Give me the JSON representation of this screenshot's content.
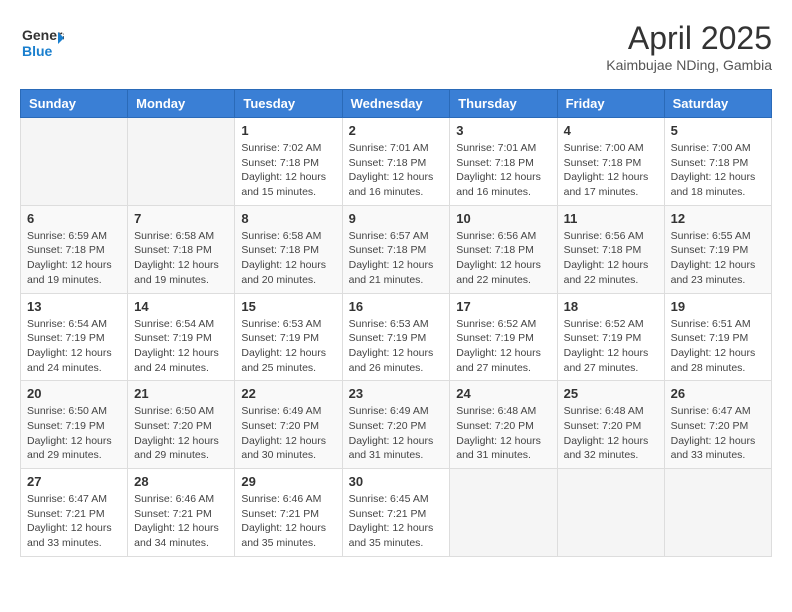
{
  "header": {
    "logo_general": "General",
    "logo_blue": "Blue",
    "title": "April 2025",
    "location": "Kaimbujae NDing, Gambia"
  },
  "days_of_week": [
    "Sunday",
    "Monday",
    "Tuesday",
    "Wednesday",
    "Thursday",
    "Friday",
    "Saturday"
  ],
  "weeks": [
    [
      {
        "day": "",
        "info": ""
      },
      {
        "day": "",
        "info": ""
      },
      {
        "day": "1",
        "info": "Sunrise: 7:02 AM\nSunset: 7:18 PM\nDaylight: 12 hours and 15 minutes."
      },
      {
        "day": "2",
        "info": "Sunrise: 7:01 AM\nSunset: 7:18 PM\nDaylight: 12 hours and 16 minutes."
      },
      {
        "day": "3",
        "info": "Sunrise: 7:01 AM\nSunset: 7:18 PM\nDaylight: 12 hours and 16 minutes."
      },
      {
        "day": "4",
        "info": "Sunrise: 7:00 AM\nSunset: 7:18 PM\nDaylight: 12 hours and 17 minutes."
      },
      {
        "day": "5",
        "info": "Sunrise: 7:00 AM\nSunset: 7:18 PM\nDaylight: 12 hours and 18 minutes."
      }
    ],
    [
      {
        "day": "6",
        "info": "Sunrise: 6:59 AM\nSunset: 7:18 PM\nDaylight: 12 hours and 19 minutes."
      },
      {
        "day": "7",
        "info": "Sunrise: 6:58 AM\nSunset: 7:18 PM\nDaylight: 12 hours and 19 minutes."
      },
      {
        "day": "8",
        "info": "Sunrise: 6:58 AM\nSunset: 7:18 PM\nDaylight: 12 hours and 20 minutes."
      },
      {
        "day": "9",
        "info": "Sunrise: 6:57 AM\nSunset: 7:18 PM\nDaylight: 12 hours and 21 minutes."
      },
      {
        "day": "10",
        "info": "Sunrise: 6:56 AM\nSunset: 7:18 PM\nDaylight: 12 hours and 22 minutes."
      },
      {
        "day": "11",
        "info": "Sunrise: 6:56 AM\nSunset: 7:18 PM\nDaylight: 12 hours and 22 minutes."
      },
      {
        "day": "12",
        "info": "Sunrise: 6:55 AM\nSunset: 7:19 PM\nDaylight: 12 hours and 23 minutes."
      }
    ],
    [
      {
        "day": "13",
        "info": "Sunrise: 6:54 AM\nSunset: 7:19 PM\nDaylight: 12 hours and 24 minutes."
      },
      {
        "day": "14",
        "info": "Sunrise: 6:54 AM\nSunset: 7:19 PM\nDaylight: 12 hours and 24 minutes."
      },
      {
        "day": "15",
        "info": "Sunrise: 6:53 AM\nSunset: 7:19 PM\nDaylight: 12 hours and 25 minutes."
      },
      {
        "day": "16",
        "info": "Sunrise: 6:53 AM\nSunset: 7:19 PM\nDaylight: 12 hours and 26 minutes."
      },
      {
        "day": "17",
        "info": "Sunrise: 6:52 AM\nSunset: 7:19 PM\nDaylight: 12 hours and 27 minutes."
      },
      {
        "day": "18",
        "info": "Sunrise: 6:52 AM\nSunset: 7:19 PM\nDaylight: 12 hours and 27 minutes."
      },
      {
        "day": "19",
        "info": "Sunrise: 6:51 AM\nSunset: 7:19 PM\nDaylight: 12 hours and 28 minutes."
      }
    ],
    [
      {
        "day": "20",
        "info": "Sunrise: 6:50 AM\nSunset: 7:19 PM\nDaylight: 12 hours and 29 minutes."
      },
      {
        "day": "21",
        "info": "Sunrise: 6:50 AM\nSunset: 7:20 PM\nDaylight: 12 hours and 29 minutes."
      },
      {
        "day": "22",
        "info": "Sunrise: 6:49 AM\nSunset: 7:20 PM\nDaylight: 12 hours and 30 minutes."
      },
      {
        "day": "23",
        "info": "Sunrise: 6:49 AM\nSunset: 7:20 PM\nDaylight: 12 hours and 31 minutes."
      },
      {
        "day": "24",
        "info": "Sunrise: 6:48 AM\nSunset: 7:20 PM\nDaylight: 12 hours and 31 minutes."
      },
      {
        "day": "25",
        "info": "Sunrise: 6:48 AM\nSunset: 7:20 PM\nDaylight: 12 hours and 32 minutes."
      },
      {
        "day": "26",
        "info": "Sunrise: 6:47 AM\nSunset: 7:20 PM\nDaylight: 12 hours and 33 minutes."
      }
    ],
    [
      {
        "day": "27",
        "info": "Sunrise: 6:47 AM\nSunset: 7:21 PM\nDaylight: 12 hours and 33 minutes."
      },
      {
        "day": "28",
        "info": "Sunrise: 6:46 AM\nSunset: 7:21 PM\nDaylight: 12 hours and 34 minutes."
      },
      {
        "day": "29",
        "info": "Sunrise: 6:46 AM\nSunset: 7:21 PM\nDaylight: 12 hours and 35 minutes."
      },
      {
        "day": "30",
        "info": "Sunrise: 6:45 AM\nSunset: 7:21 PM\nDaylight: 12 hours and 35 minutes."
      },
      {
        "day": "",
        "info": ""
      },
      {
        "day": "",
        "info": ""
      },
      {
        "day": "",
        "info": ""
      }
    ]
  ]
}
